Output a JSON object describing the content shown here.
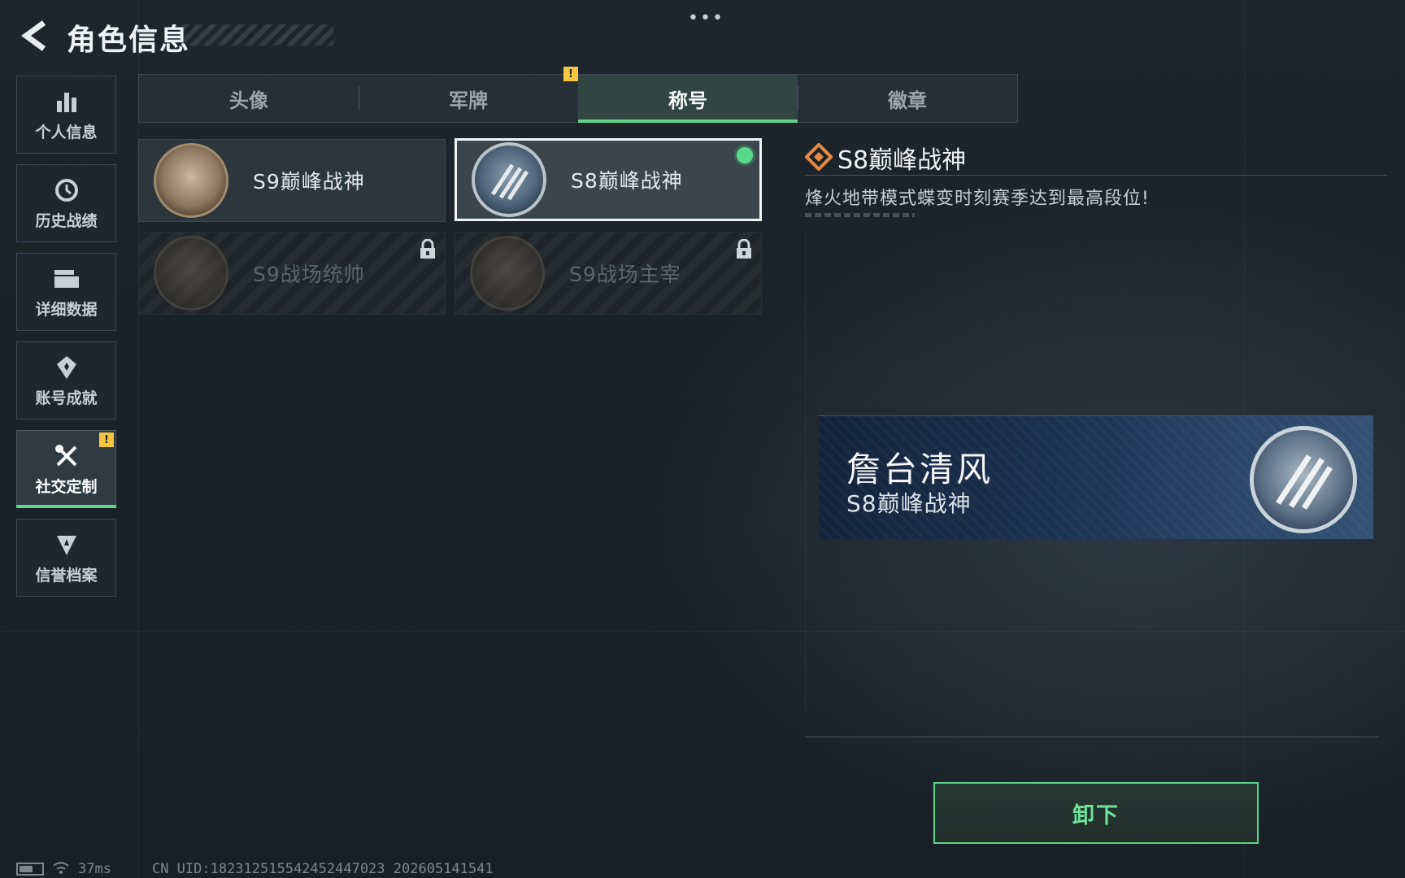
{
  "header": {
    "title": "角色信息",
    "more": "•••"
  },
  "sidebar": {
    "items": [
      {
        "label": "个人信息",
        "icon": "bar-chart-icon",
        "active": false
      },
      {
        "label": "历史战绩",
        "icon": "history-clock-icon",
        "active": false
      },
      {
        "label": "详细数据",
        "icon": "folder-icon",
        "active": false
      },
      {
        "label": "账号成就",
        "icon": "achievement-badge-icon",
        "active": false
      },
      {
        "label": "社交定制",
        "icon": "tools-icon",
        "active": true,
        "badge": "!"
      },
      {
        "label": "信誉档案",
        "icon": "shield-icon",
        "active": false
      }
    ]
  },
  "tabs": [
    {
      "label": "头像",
      "active": false
    },
    {
      "label": "军牌",
      "active": false,
      "badge": "!"
    },
    {
      "label": "称号",
      "active": true
    },
    {
      "label": "徽章",
      "active": false
    }
  ],
  "titles": [
    {
      "name": "S9巅峰战神",
      "state": "owned"
    },
    {
      "name": "S8巅峰战神",
      "state": "equipped"
    },
    {
      "name": "S9战场统帅",
      "state": "locked"
    },
    {
      "name": "S9战场主宰",
      "state": "locked"
    }
  ],
  "detail": {
    "title": "S8巅峰战神",
    "description": "烽火地带模式蝶变时刻赛季达到最高段位!"
  },
  "preview": {
    "player_name": "詹台清风",
    "title": "S8巅峰战神"
  },
  "actions": {
    "unequip_label": "卸下"
  },
  "status": {
    "ping": "37ms",
    "uid": "CN UID:1823125155424524470​23 202605141541"
  },
  "colors": {
    "accent_green": "#5ed48a",
    "warning_yellow": "#f3c540",
    "detail_icon_orange": "#e88a46"
  }
}
